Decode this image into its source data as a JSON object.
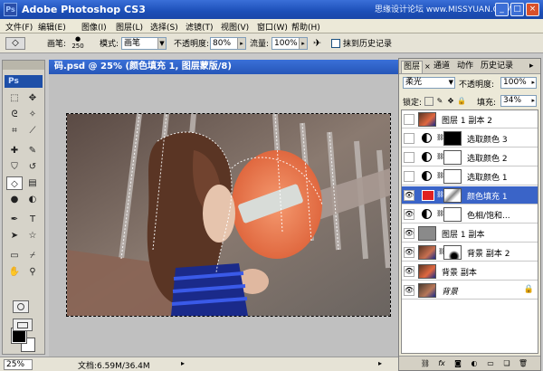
{
  "app": {
    "title": "Adobe Photoshop CS3",
    "badge": "Ps",
    "watermark": "思缘设计论坛 www.MISSYUAN.COM"
  },
  "window_buttons": {
    "minimize": "_",
    "maximize": "□",
    "close": "×"
  },
  "menu": [
    "文件(F)",
    "编辑(E)",
    "图像(I)",
    "图层(L)",
    "选择(S)",
    "滤镜(T)",
    "视图(V)",
    "窗口(W)",
    "帮助(H)"
  ],
  "options": {
    "brush_label": "画笔:",
    "brush_size": "250",
    "mode_label": "模式:",
    "mode_value": "画笔",
    "opacity_label": "不透明度:",
    "opacity_value": "80%",
    "flow_label": "流量:",
    "flow_value": "100%",
    "history_label": "抹到历史记录"
  },
  "toolbox": {
    "logo": "Ps"
  },
  "document": {
    "tab_title": "码.psd @ 25% (颜色填充 1, 图层蒙版/8)",
    "zoom": "25%",
    "doc_info": "文档:6.59M/36.4M"
  },
  "layers_panel": {
    "tabs": [
      "图层",
      "通道",
      "动作",
      "历史记录"
    ],
    "blend_mode": "柔光",
    "opacity_label": "不透明度:",
    "opacity_value": "100%",
    "lock_label": "锁定:",
    "fill_label": "填充:",
    "fill_value": "34%",
    "layers": [
      {
        "name": "图层 1 副本 2",
        "visible": false,
        "selected": false
      },
      {
        "name": "选取颜色 3",
        "visible": false,
        "selected": false
      },
      {
        "name": "选取颜色 2",
        "visible": false,
        "selected": false
      },
      {
        "name": "选取颜色 1",
        "visible": false,
        "selected": false
      },
      {
        "name": "颜色填充 1",
        "visible": true,
        "selected": true
      },
      {
        "name": "色相/饱和...",
        "visible": true,
        "selected": false
      },
      {
        "name": "图层 1 副本",
        "visible": true,
        "selected": false
      },
      {
        "name": "背景 副本 2",
        "visible": true,
        "selected": false
      },
      {
        "name": "背景 副本",
        "visible": true,
        "selected": false
      },
      {
        "name": "背景",
        "visible": true,
        "selected": false
      }
    ],
    "footer_icons": [
      "link-icon",
      "fx-icon",
      "mask-icon",
      "adjustment-icon",
      "group-icon",
      "new-layer-icon",
      "trash-icon"
    ]
  }
}
